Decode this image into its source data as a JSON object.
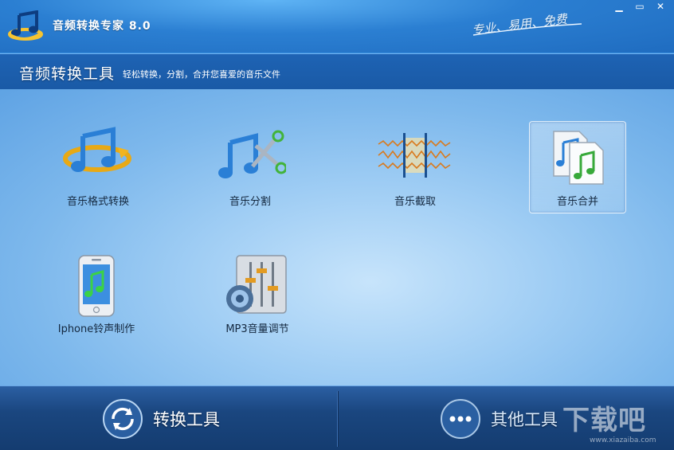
{
  "app": {
    "title": "音频转换专家  8.0",
    "slogan": "专业、易用、免费"
  },
  "window_controls": {
    "minimize": "▁",
    "menu": "▭",
    "close": "✕"
  },
  "header": {
    "title": "音频转换工具",
    "subtitle": "轻松转换，分割，合并您喜爱的音乐文件"
  },
  "tools": [
    {
      "label": "音乐格式转换",
      "icon": "music-convert-icon"
    },
    {
      "label": "音乐分割",
      "icon": "music-split-icon"
    },
    {
      "label": "音乐截取",
      "icon": "music-cut-icon"
    },
    {
      "label": "音乐合并",
      "icon": "music-merge-icon",
      "selected": true
    },
    {
      "label": "Iphone铃声制作",
      "icon": "iphone-ringtone-icon"
    },
    {
      "label": "MP3音量调节",
      "icon": "mp3-volume-icon"
    }
  ],
  "bottom": {
    "convert_label": "转换工具",
    "other_label": "其他工具"
  },
  "watermark": {
    "text": "下载吧",
    "url": "www.xiazaiba.com"
  },
  "colors": {
    "accent": "#1e63b4",
    "bottom": "#1a467f"
  }
}
